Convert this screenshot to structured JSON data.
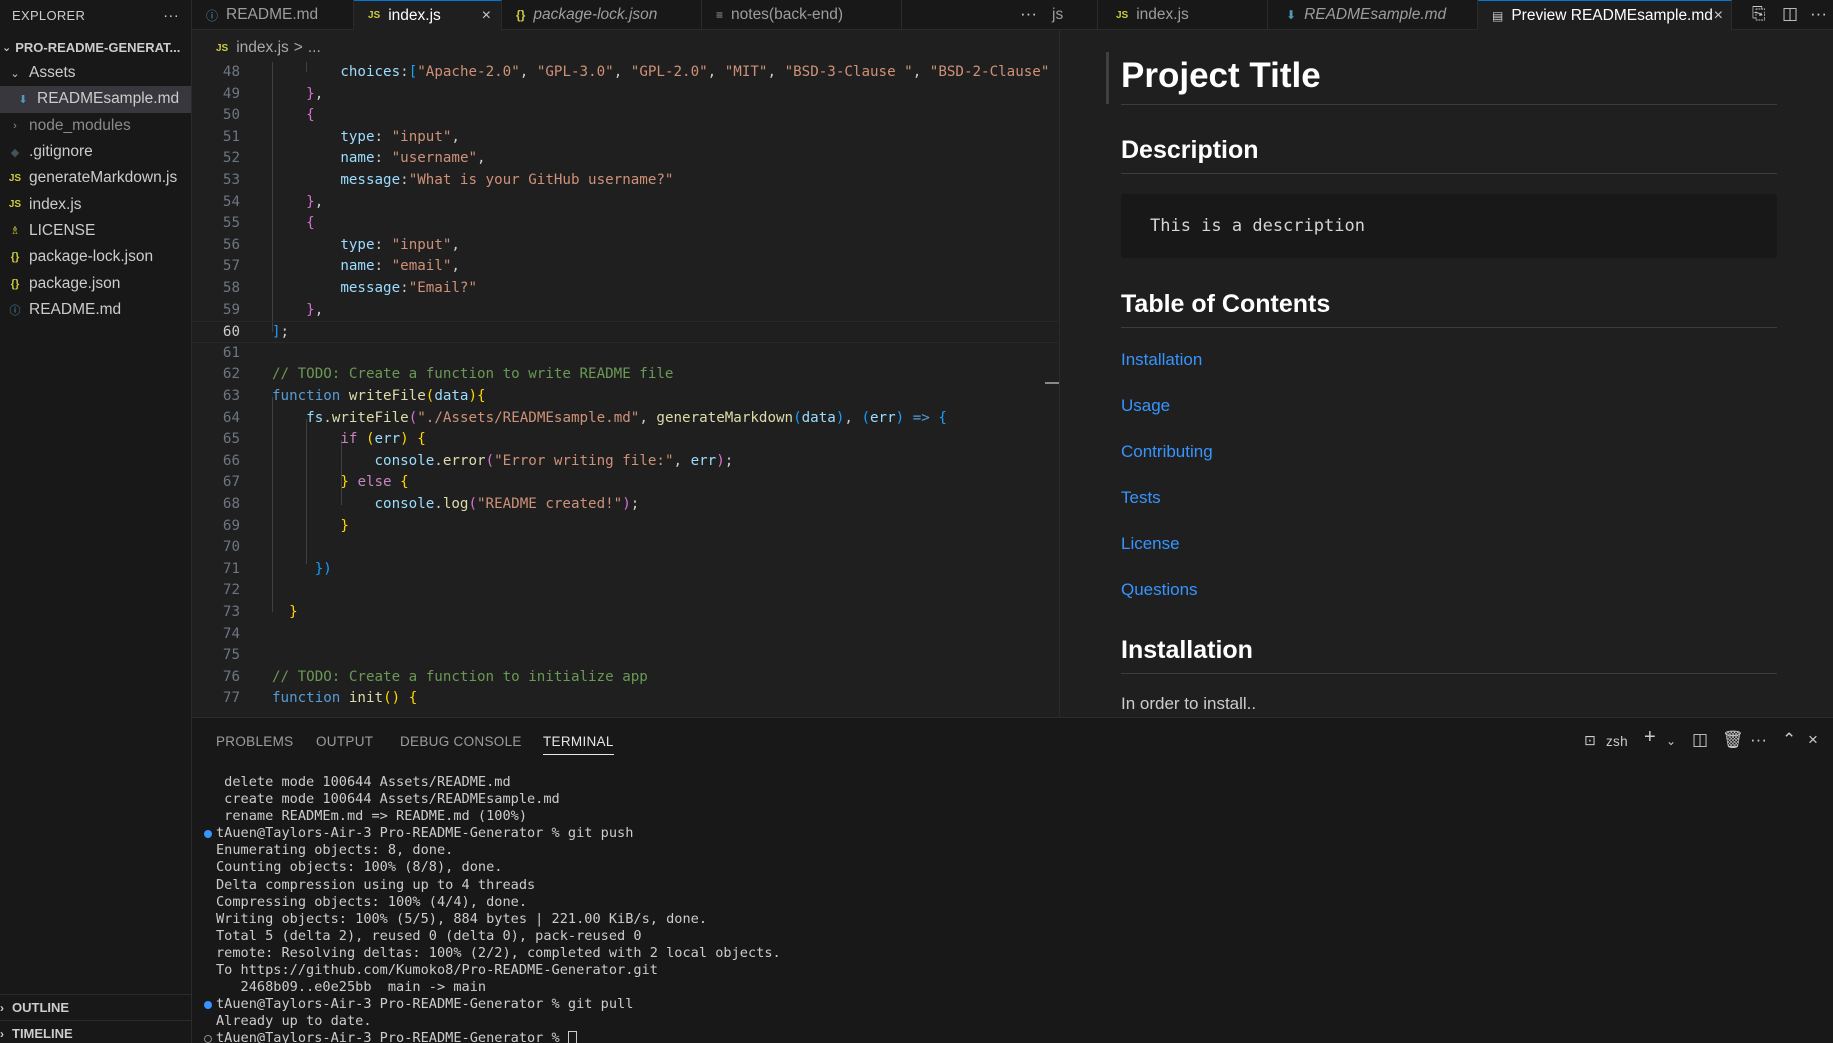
{
  "sidebar": {
    "title": "EXPLORER",
    "more": "···",
    "project": "PRO-README-GENERAT...",
    "items": [
      {
        "label": "Assets",
        "icon": "chevron-down-icon"
      },
      {
        "label": "READMEsample.md",
        "icon": "markdown-icon"
      },
      {
        "label": "node_modules",
        "icon": "chevron-right-icon"
      },
      {
        "label": ".gitignore",
        "icon": "git-icon"
      },
      {
        "label": "generateMarkdown.js",
        "icon": "js-icon"
      },
      {
        "label": "index.js",
        "icon": "js-icon"
      },
      {
        "label": "LICENSE",
        "icon": "license-icon"
      },
      {
        "label": "package-lock.json",
        "icon": "json-icon"
      },
      {
        "label": "package.json",
        "icon": "json-icon"
      },
      {
        "label": "README.md",
        "icon": "info-icon"
      }
    ],
    "outline": "OUTLINE",
    "timeline": "TIMELINE"
  },
  "tabs": [
    {
      "label": "README.md",
      "icon": "info-icon"
    },
    {
      "label": "index.js",
      "icon": "js-icon"
    },
    {
      "label": "package-lock.json",
      "icon": "json-icon"
    },
    {
      "label": "notes(back-end)",
      "icon": "text-icon"
    },
    {
      "label": "js",
      "icon": ""
    },
    {
      "label": "index.js",
      "icon": "js-icon"
    },
    {
      "label": "READMEsample.md",
      "icon": "markdown-icon"
    },
    {
      "label": "Preview READMEsample.md",
      "icon": "preview-icon"
    }
  ],
  "breadcrumb": {
    "file": "index.js",
    "sep": ">",
    "rest": "..."
  },
  "editor": {
    "line_numbers": [
      "48",
      "49",
      "50",
      "51",
      "52",
      "53",
      "54",
      "55",
      "56",
      "57",
      "58",
      "59",
      "60",
      "61",
      "62",
      "63",
      "64",
      "65",
      "66",
      "67",
      "68",
      "69",
      "70",
      "71",
      "72",
      "73",
      "74",
      "75",
      "76",
      "77"
    ],
    "current_line": "60"
  },
  "preview": {
    "title": "Project Title",
    "h_description": "Description",
    "description_code": "This is a description",
    "h_toc": "Table of Contents",
    "toc": [
      "Installation",
      "Usage",
      "Contributing",
      "Tests",
      "License",
      "Questions"
    ],
    "h_installation": "Installation",
    "installation_text": "In order to install.."
  },
  "panel": {
    "tabs": [
      "PROBLEMS",
      "OUTPUT",
      "DEBUG CONSOLE",
      "TERMINAL"
    ],
    "shell": "zsh",
    "terminal_lines": [
      " delete mode 100644 Assets/README.md",
      " create mode 100644 Assets/READMEsample.md",
      " rename READMEm.md => README.md (100%)",
      "tAuen@Taylors-Air-3 Pro-README-Generator % git push",
      "Enumerating objects: 8, done.",
      "Counting objects: 100% (8/8), done.",
      "Delta compression using up to 4 threads",
      "Compressing objects: 100% (4/4), done.",
      "Writing objects: 100% (5/5), 884 bytes | 221.00 KiB/s, done.",
      "Total 5 (delta 2), reused 0 (delta 0), pack-reused 0",
      "remote: Resolving deltas: 100% (2/2), completed with 2 local objects.",
      "To https://github.com/Kumoko8/Pro-README-Generator.git",
      "   2468b09..e0e25bb  main -> main",
      "tAuen@Taylors-Air-3 Pro-README-Generator % git pull",
      "Already up to date.",
      "tAuen@Taylors-Air-3 Pro-README-Generator % "
    ]
  }
}
